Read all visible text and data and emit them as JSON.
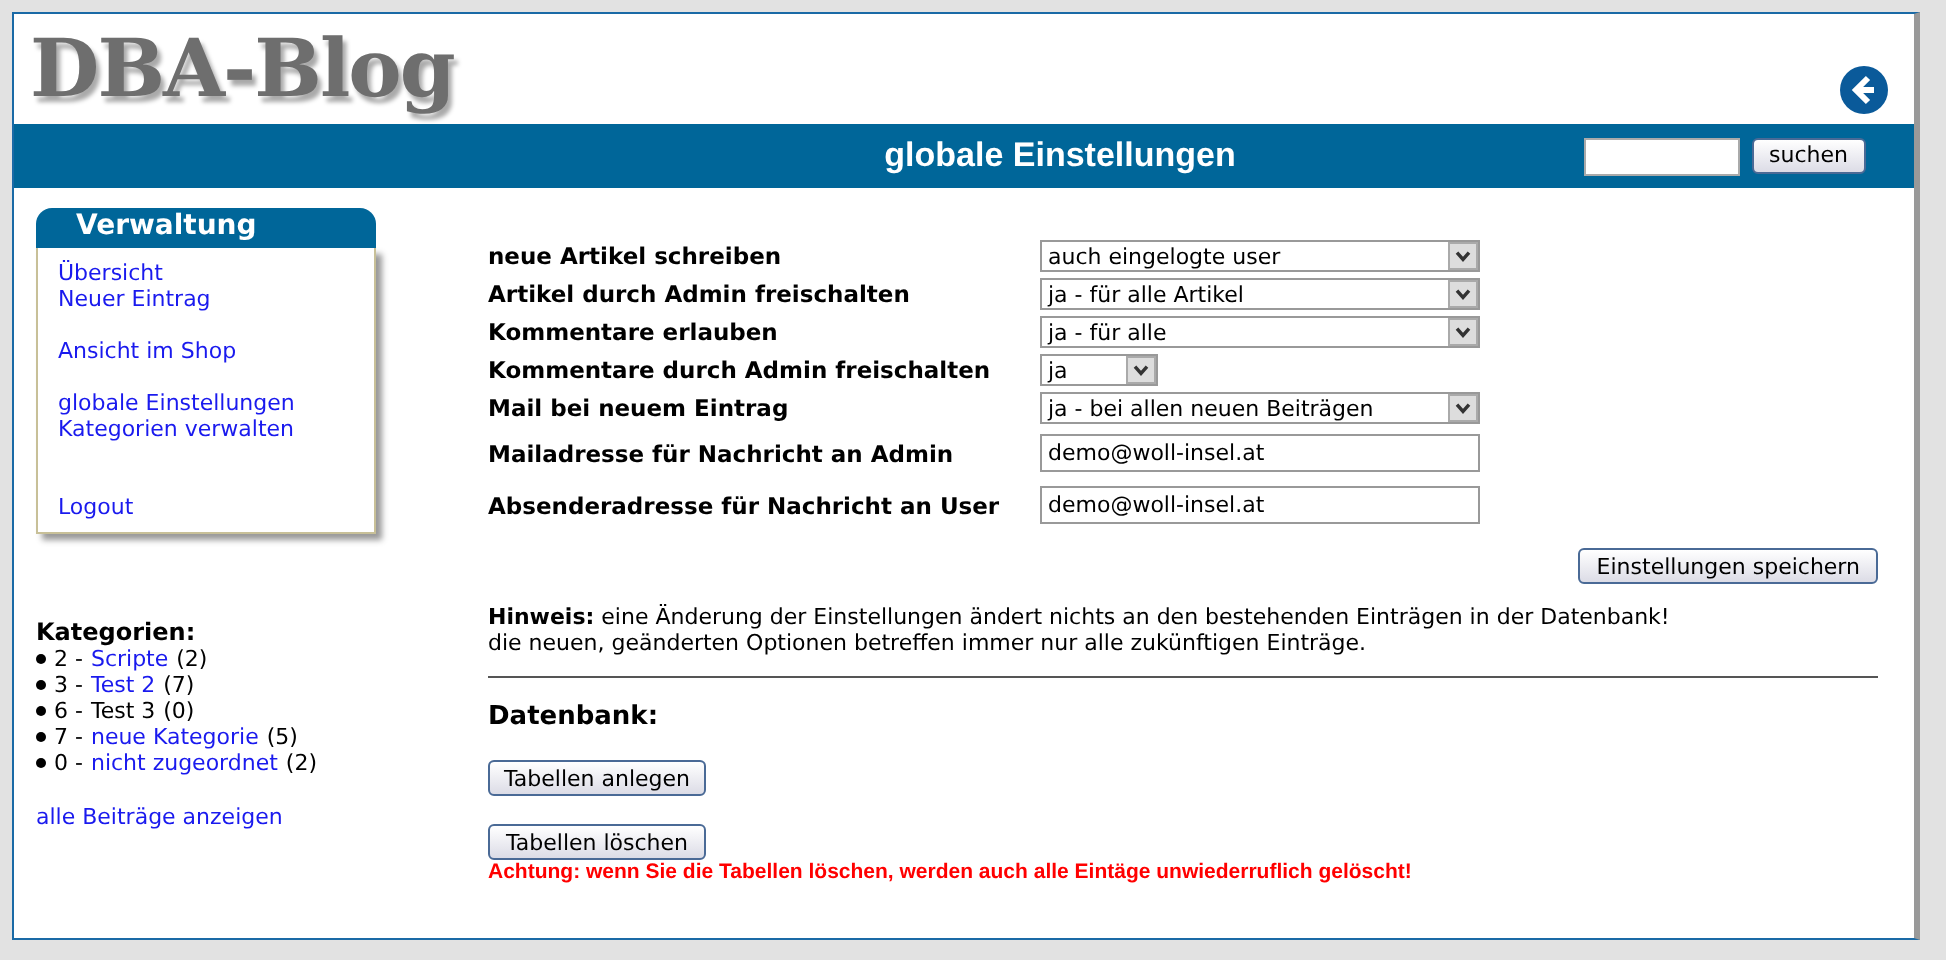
{
  "logo": "DBA-Blog",
  "title": "globale Einstellungen",
  "search": {
    "button": "suchen"
  },
  "sidebar": {
    "title": "Verwaltung",
    "groups": [
      [
        "Übersicht",
        "Neuer Eintrag"
      ],
      [
        "Ansicht im Shop"
      ],
      [
        "globale Einstellungen",
        "Kategorien verwalten"
      ],
      [
        "Logout"
      ]
    ]
  },
  "categories": {
    "title": "Kategorien:",
    "items": [
      {
        "prefix": "2 -",
        "name": "Scripte",
        "count": "(2)",
        "link": true
      },
      {
        "prefix": "3 -",
        "name": "Test 2",
        "count": "(7)",
        "link": true
      },
      {
        "prefix": "6 -",
        "name": "Test 3",
        "count": "(0)",
        "link": false
      },
      {
        "prefix": "7 -",
        "name": "neue Kategorie",
        "count": "(5)",
        "link": true
      },
      {
        "prefix": "0 -",
        "name": "nicht zugeordnet",
        "count": "(2)",
        "link": true
      }
    ],
    "all_link": "alle Beiträge anzeigen"
  },
  "settings": [
    {
      "label": "neue Artikel schreiben",
      "kind": "select",
      "value": "auch eingelogte user"
    },
    {
      "label": "Artikel durch Admin freischalten",
      "kind": "select",
      "value": "ja - für alle Artikel"
    },
    {
      "label": "Kommentare erlauben",
      "kind": "select",
      "value": "ja - für alle"
    },
    {
      "label": "Kommentare durch Admin freischalten",
      "kind": "small-select",
      "value": "ja"
    },
    {
      "label": "Mail bei neuem Eintrag",
      "kind": "select",
      "value": "ja - bei allen neuen Beiträgen"
    },
    {
      "label": "Mailadresse für Nachricht an Admin",
      "kind": "text",
      "value": "demo@woll-insel.at"
    },
    {
      "label": "Absenderadresse für Nachricht an User",
      "kind": "text",
      "value": "demo@woll-insel.at"
    }
  ],
  "save_button": "Einstellungen speichern",
  "notice": [
    "**Hinweis:** eine Änderung der Einstellungen ändert nichts an den bestehenden Einträgen in der Datenbank!",
    "die neuen, geänderten Optionen betreffen immer nur alle zukünftigen Einträge."
  ],
  "database": {
    "title": "Datenbank:",
    "create_button": "Tabellen anlegen",
    "delete_button": "Tabellen löschen",
    "warning": "Achtung: wenn Sie die Tabellen löschen, werden auch alle Eintäge unwiederruflich gelöscht!"
  }
}
